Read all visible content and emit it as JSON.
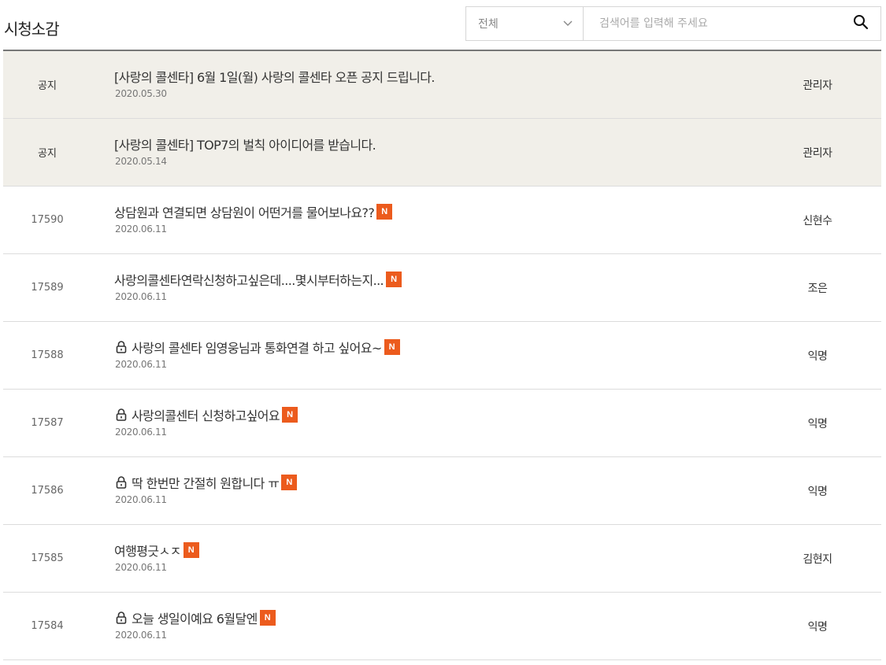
{
  "page": {
    "title": "시청소감"
  },
  "search": {
    "category": "전체",
    "placeholder": "검색어를 입력해 주세요",
    "value": ""
  },
  "posts": [
    {
      "type": "notice",
      "num": "공지",
      "title": "[사랑의 콜센타] 6월 1일(월) 사랑의 콜센타 오픈 공지 드립니다.",
      "date": "2020.05.30",
      "author": "관리자",
      "locked": false,
      "new": false
    },
    {
      "type": "notice",
      "num": "공지",
      "title": "[사랑의 콜센타] TOP7의 벌칙 아이디어를 받습니다.",
      "date": "2020.05.14",
      "author": "관리자",
      "locked": false,
      "new": false
    },
    {
      "type": "post",
      "num": "17590",
      "title": "상담원과 연결되면 상담원이 어떤거를 물어보나요??",
      "date": "2020.06.11",
      "author": "신현수",
      "locked": false,
      "new": true
    },
    {
      "type": "post",
      "num": "17589",
      "title": "사랑의콜센타연락신청하고싶은데....몇시부터하는지...",
      "date": "2020.06.11",
      "author": "조은",
      "locked": false,
      "new": true
    },
    {
      "type": "post",
      "num": "17588",
      "title": "사랑의 콜센타 임영웅님과 통화연결 하고 싶어요~",
      "date": "2020.06.11",
      "author": "익명",
      "locked": true,
      "new": true
    },
    {
      "type": "post",
      "num": "17587",
      "title": "사랑의콜센터 신청하고싶어요",
      "date": "2020.06.11",
      "author": "익명",
      "locked": true,
      "new": true
    },
    {
      "type": "post",
      "num": "17586",
      "title": "딱 한번만 간절히 원합니다 ㅠ",
      "date": "2020.06.11",
      "author": "익명",
      "locked": true,
      "new": true
    },
    {
      "type": "post",
      "num": "17585",
      "title": "여행평긋ㅅㅈ",
      "date": "2020.06.11",
      "author": "김현지",
      "locked": false,
      "new": true
    },
    {
      "type": "post",
      "num": "17584",
      "title": "오늘 생일이예요 6월달엔",
      "date": "2020.06.11",
      "author": "익명",
      "locked": true,
      "new": true
    }
  ],
  "badge": {
    "new_label": "N",
    "new_color": "#ec5b1d"
  },
  "icons": {
    "lock": "lock-icon",
    "search": "search-icon",
    "dropdown": "chevron-down-icon"
  }
}
